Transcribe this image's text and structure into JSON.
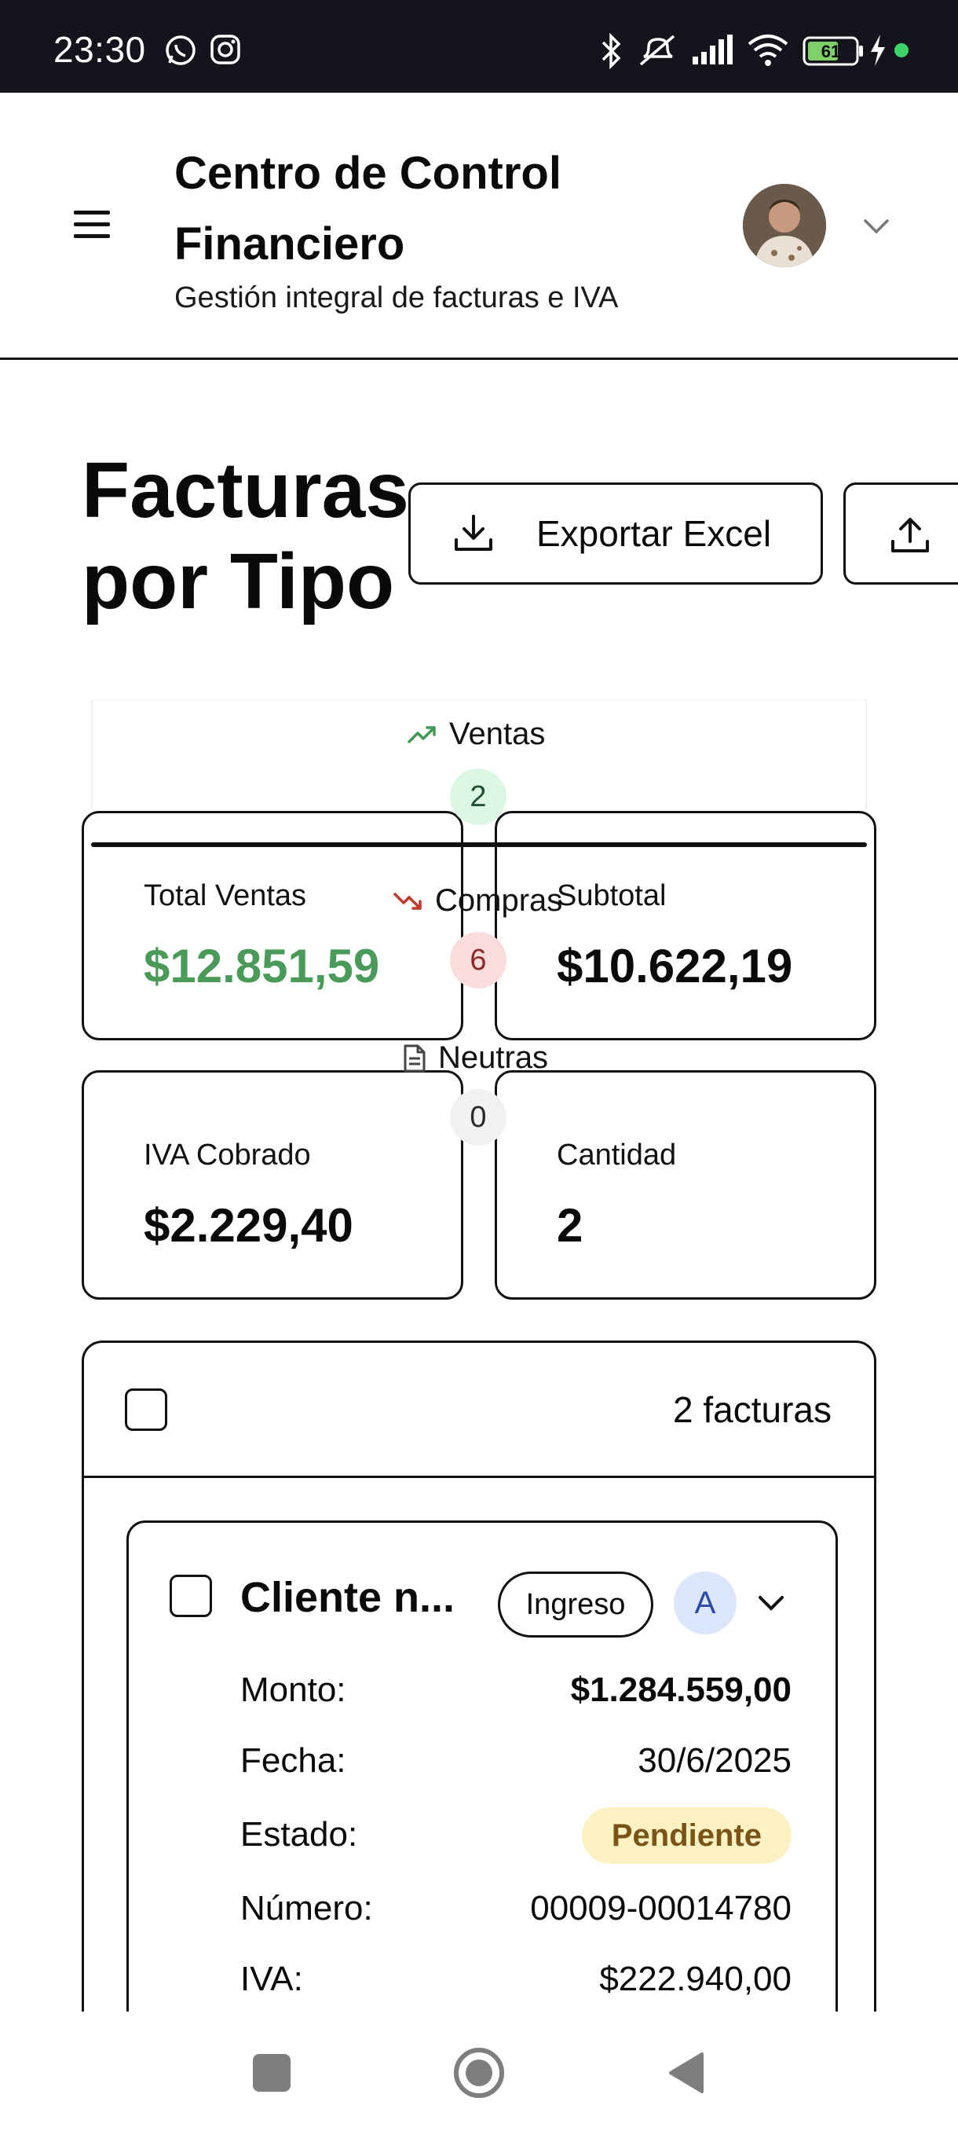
{
  "status_bar": {
    "time": "23:30",
    "battery": "61",
    "icons": [
      "whatsapp-icon",
      "instagram-icon",
      "bluetooth-icon",
      "mute-icon",
      "signal-icon",
      "wifi-icon",
      "battery-icon",
      "charging-icon",
      "dot-icon"
    ]
  },
  "header": {
    "title": "Centro de Control Financiero",
    "subtitle": "Gestión integral de facturas e IVA"
  },
  "page": {
    "title": "Facturas por Tipo",
    "export_label": "Exportar Excel"
  },
  "tabs": [
    {
      "label": "Ventas",
      "count": "2",
      "icon": "trending-up-icon",
      "color": "#3f9a55"
    },
    {
      "label": "Compras",
      "count": "6",
      "icon": "trending-down-icon",
      "color": "#c0392b"
    },
    {
      "label": "Neutras",
      "count": "0",
      "icon": "document-icon",
      "color": "#444444"
    }
  ],
  "stats": {
    "total_ventas_label": "Total Ventas",
    "total_ventas_value": "$12.851,59",
    "subtotal_label": "Subtotal",
    "subtotal_value": "$10.622,19",
    "iva_label": "IVA Cobrado",
    "iva_value": "$2.229,40",
    "cantidad_label": "Cantidad",
    "cantidad_value": "2"
  },
  "list": {
    "count_label": "2 facturas",
    "invoice": {
      "name": "Cliente n...",
      "tipo": "Ingreso",
      "letra": "A",
      "rows": {
        "monto_label": "Monto:",
        "monto_value": "$1.284.559,00",
        "fecha_label": "Fecha:",
        "fecha_value": "30/6/2025",
        "estado_label": "Estado:",
        "estado_value": "Pendiente",
        "numero_label": "Número:",
        "numero_value": "00009-00014780",
        "iva_label": "IVA:",
        "iva_value": "$222.940,00"
      }
    }
  },
  "colors": {
    "accent_green": "#4a9a5a",
    "pending_bg": "#fbf1c2",
    "pending_text": "#7a5416",
    "letter_bg": "#dbe6fb"
  }
}
